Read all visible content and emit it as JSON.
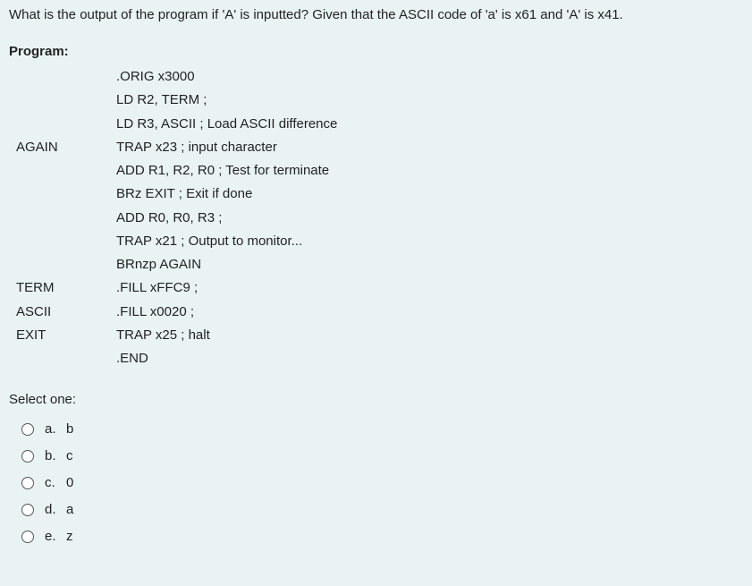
{
  "question": "What is the output of the program if 'A' is inputted? Given that the ASCII code of 'a' is x61 and 'A' is x41.",
  "program_label": "Program:",
  "code": [
    {
      "label": "",
      "instr": ".ORIG x3000"
    },
    {
      "label": "",
      "instr": "LD R2, TERM ;"
    },
    {
      "label": "",
      "instr": "LD R3, ASCII ; Load ASCII difference"
    },
    {
      "label": "AGAIN",
      "instr": "TRAP x23 ; input character"
    },
    {
      "label": "",
      "instr": "ADD R1, R2, R0 ; Test for terminate"
    },
    {
      "label": "",
      "instr": "BRz EXIT ; Exit if done"
    },
    {
      "label": "",
      "instr": "ADD R0, R0, R3 ;"
    },
    {
      "label": "",
      "instr": "TRAP x21 ; Output to monitor..."
    },
    {
      "label": "",
      "instr": "BRnzp AGAIN"
    },
    {
      "label": "TERM",
      "instr": ".FILL xFFC9 ;"
    },
    {
      "label": "ASCII",
      "instr": ".FILL x0020 ;"
    },
    {
      "label": "EXIT",
      "instr": "TRAP x25 ; halt"
    },
    {
      "label": "",
      "instr": ".END"
    }
  ],
  "select_one": "Select one:",
  "options": [
    {
      "letter": "a.",
      "text": "b"
    },
    {
      "letter": "b.",
      "text": "c"
    },
    {
      "letter": "c.",
      "text": "0"
    },
    {
      "letter": "d.",
      "text": "a"
    },
    {
      "letter": "e.",
      "text": "z"
    }
  ]
}
